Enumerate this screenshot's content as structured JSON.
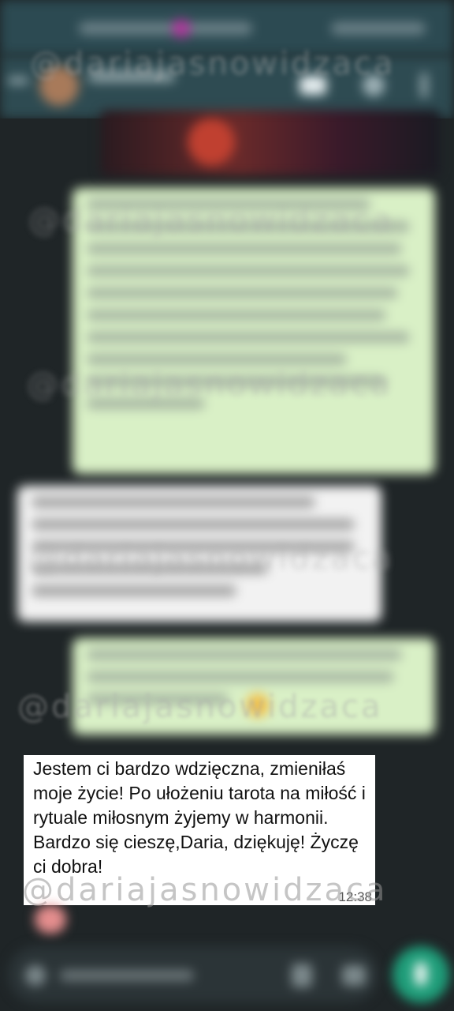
{
  "watermarks": [
    "@dariajasnowidzaca",
    "@dariajasnowidzaca",
    "@dariajasnowidzaca",
    "@dariajasnowidzaca",
    "@dariajasnowidzaca",
    "@dariajasnowidzaca"
  ],
  "message": {
    "text": "Jestem ci bardzo wdzięczna, zmieniłaś moje życie! Po ułożeniu tarota na miłość i rytuale miłosnym żyjemy w harmonii. Bardzo się cieszę,Daria, dziękuję! Życzę ci dobra!",
    "time": "12:38"
  },
  "colors": {
    "header": "#2e4b52",
    "chat_bg": "#1f2527",
    "outgoing_bubble": "#d9f0c6",
    "incoming_bubble": "#ffffff",
    "send_button": "#1f9e7a"
  },
  "icons": [
    "back-arrow-icon",
    "avatar",
    "video-call-icon",
    "phone-icon",
    "more-icon",
    "emoji-icon",
    "attach-icon",
    "camera-icon",
    "mic-icon"
  ]
}
